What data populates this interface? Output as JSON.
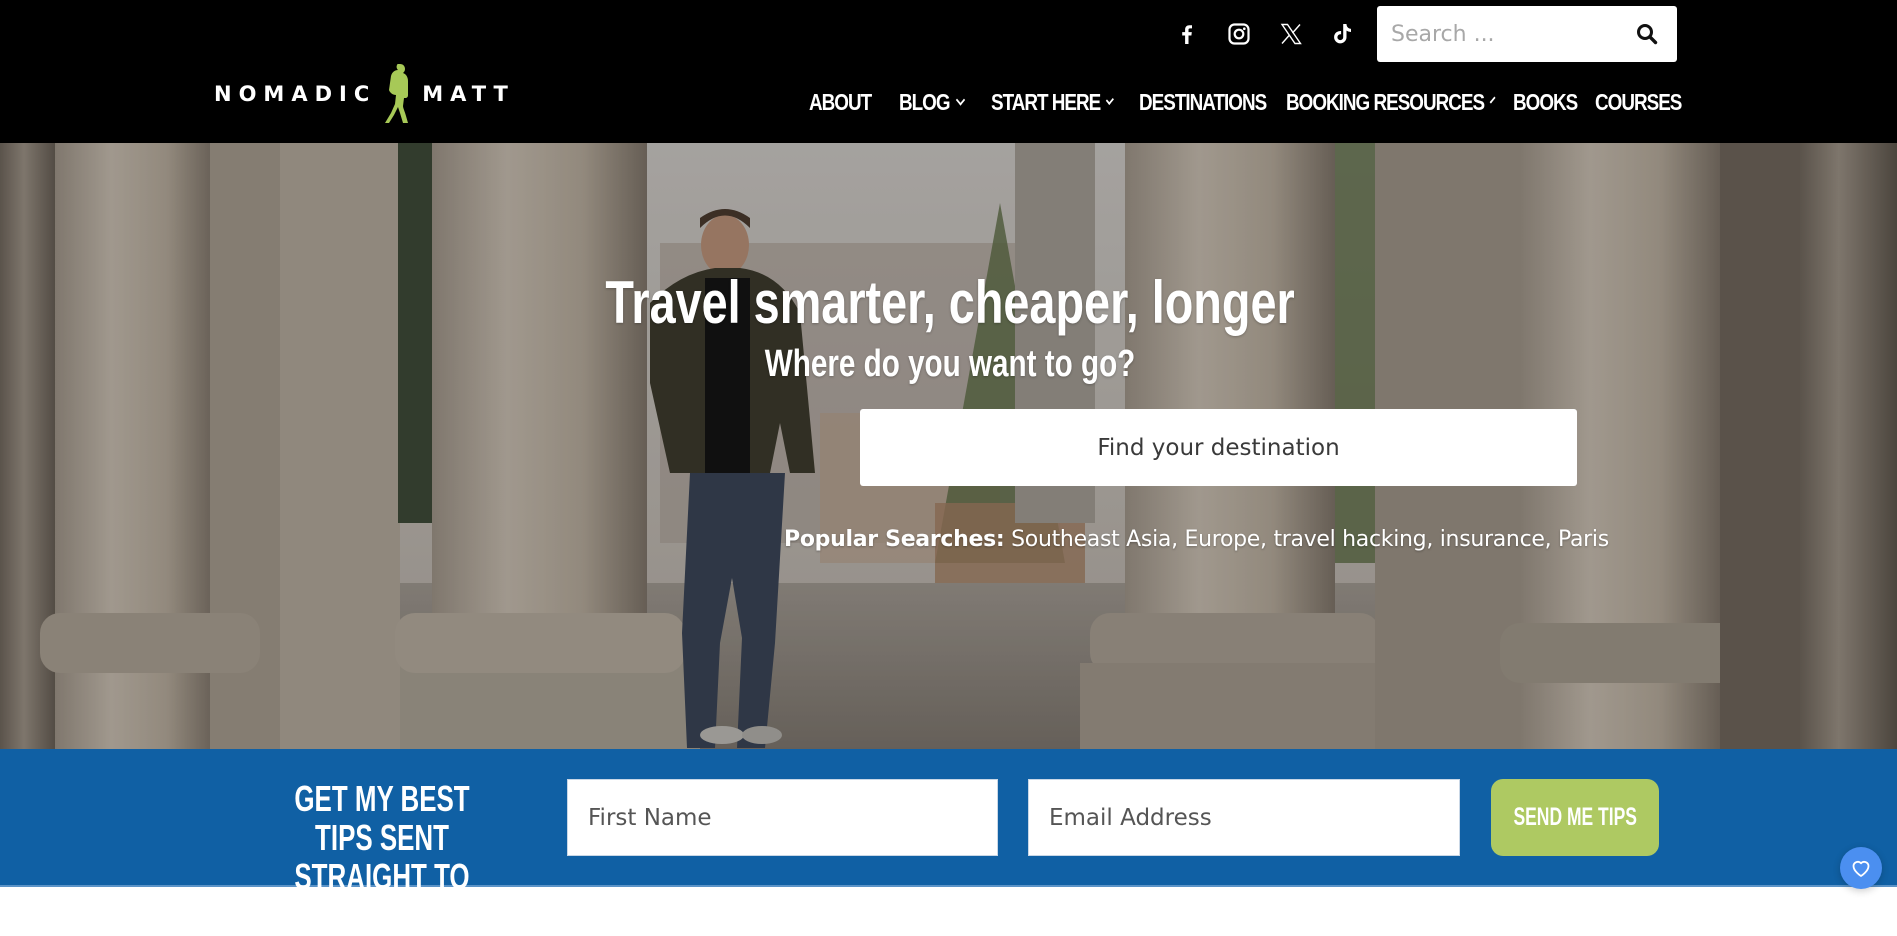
{
  "brand": {
    "logo_left": "NOMADIC",
    "logo_right": "MATT",
    "logo_color": "#a7c957"
  },
  "header": {
    "social": [
      {
        "name": "facebook",
        "icon": "facebook-icon"
      },
      {
        "name": "instagram",
        "icon": "instagram-icon"
      },
      {
        "name": "x",
        "icon": "x-twitter-icon"
      },
      {
        "name": "tiktok",
        "icon": "tiktok-icon"
      }
    ],
    "search_placeholder": "Search ...",
    "nav": [
      {
        "label": "ABOUT",
        "dropdown": false
      },
      {
        "label": "BLOG",
        "dropdown": true
      },
      {
        "label": "START HERE",
        "dropdown": true
      },
      {
        "label": "DESTINATIONS",
        "dropdown": false
      },
      {
        "label": "BOOKING RESOURCES",
        "dropdown": true
      },
      {
        "label": "BOOKS",
        "dropdown": false
      },
      {
        "label": "COURSES",
        "dropdown": false
      }
    ]
  },
  "hero": {
    "title": "Travel smarter, cheaper, longer",
    "subtitle": "Where do you want to go?",
    "search_placeholder": "Find your destination",
    "popular_label": "Popular Searches:",
    "popular_links": [
      "Southeast Asia",
      "Europe",
      "travel hacking",
      "insurance",
      "Paris"
    ]
  },
  "signup": {
    "title": "GET MY BEST TIPS SENT STRAIGHT TO YOU!",
    "first_name_placeholder": "First Name",
    "email_placeholder": "Email Address",
    "button_label": "SEND ME TIPS",
    "band_color": "#1060a4",
    "button_color": "#aec962"
  },
  "floating": {
    "icon": "heart-icon",
    "color": "#4b8ff0"
  }
}
